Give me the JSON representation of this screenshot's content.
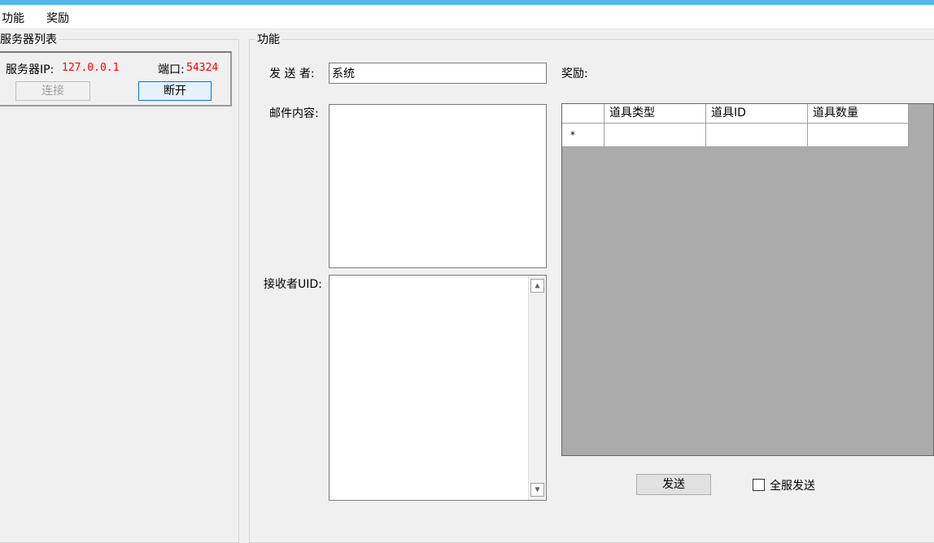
{
  "menu": {
    "items": [
      "功能",
      "奖励"
    ]
  },
  "server_list": {
    "title": "服务器列表",
    "ip_label": "服务器IP:",
    "ip_value": "127.0.0.1",
    "port_label": "端口:",
    "port_value": "54324",
    "connect_label": "连接",
    "disconnect_label": "断开"
  },
  "function": {
    "title": "功能",
    "sender_label": "发 送 者:",
    "sender_value": "系统",
    "content_label": "邮件内容:",
    "content_value": "",
    "receiver_label": "接收者UID:",
    "receiver_value": "",
    "reward_label": "奖励:",
    "grid": {
      "columns": [
        "道具类型",
        "道具ID",
        "道具数量"
      ],
      "new_row_marker": "*"
    },
    "send_label": "发送",
    "all_server_label": "全服发送",
    "all_server_checked": false
  },
  "colors": {
    "accent_top": "#52b9ea",
    "value_red": "#ff0000",
    "grid_background": "#ababab"
  }
}
